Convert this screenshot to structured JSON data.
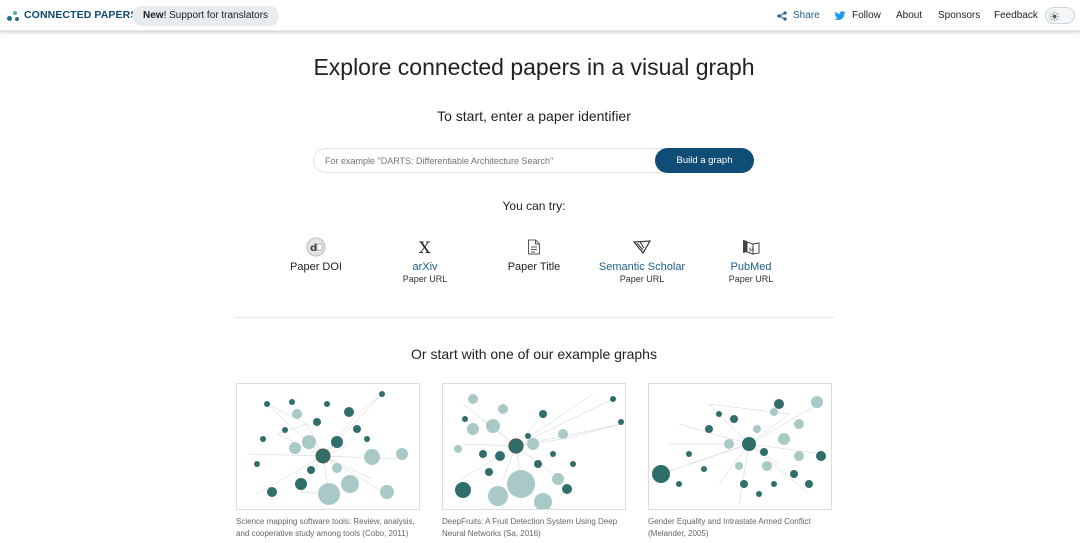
{
  "header": {
    "logo_text": "CONNECTED PAPERS",
    "pill_bold": "New",
    "pill_text": "! Support for translators",
    "nav": {
      "share": "Share",
      "follow": "Follow",
      "about": "About",
      "sponsors": "Sponsors",
      "feedback": "Feedback"
    },
    "theme_toggle_icon": "sun-icon"
  },
  "hero": {
    "title": "Explore connected papers in a visual graph",
    "subtitle": "To start, enter a paper identifier",
    "search_placeholder": "For example \"DARTS: Differentiable Architecture Search\"",
    "build_button": "Build a graph",
    "try_label": "You can try:"
  },
  "options": [
    {
      "label": "Paper DOI",
      "sub": "",
      "icon": "doi-icon"
    },
    {
      "label": "arXiv",
      "sub": "Paper URL",
      "icon": "arxiv-icon"
    },
    {
      "label": "Paper Title",
      "sub": "",
      "icon": "document-icon"
    },
    {
      "label": "Semantic Scholar",
      "sub": "Paper URL",
      "icon": "semantic-scholar-icon"
    },
    {
      "label": "PubMed",
      "sub": "Paper URL",
      "icon": "pubmed-icon"
    }
  ],
  "examples": {
    "heading": "Or start with one of our example graphs",
    "items": [
      {
        "caption_line1": "Science mapping software tools: Review, analysis,",
        "caption_line2": "and cooperative study among tools (Cobo, 2011)"
      },
      {
        "caption_line1": "DeepFruits: A Fruit Detection System Using Deep",
        "caption_line2": "Neural Networks (Sa, 2016)"
      },
      {
        "caption_line1": "Gender Equality and Intrastate Armed Conflict",
        "caption_line2": "(Melander, 2005)"
      }
    ]
  },
  "colors": {
    "brand": "#0c4a6e",
    "button": "#0f4d76",
    "link": "#1c5f8c",
    "node_dark": "#2f6e6a",
    "node_light": "#a9c9c6"
  }
}
